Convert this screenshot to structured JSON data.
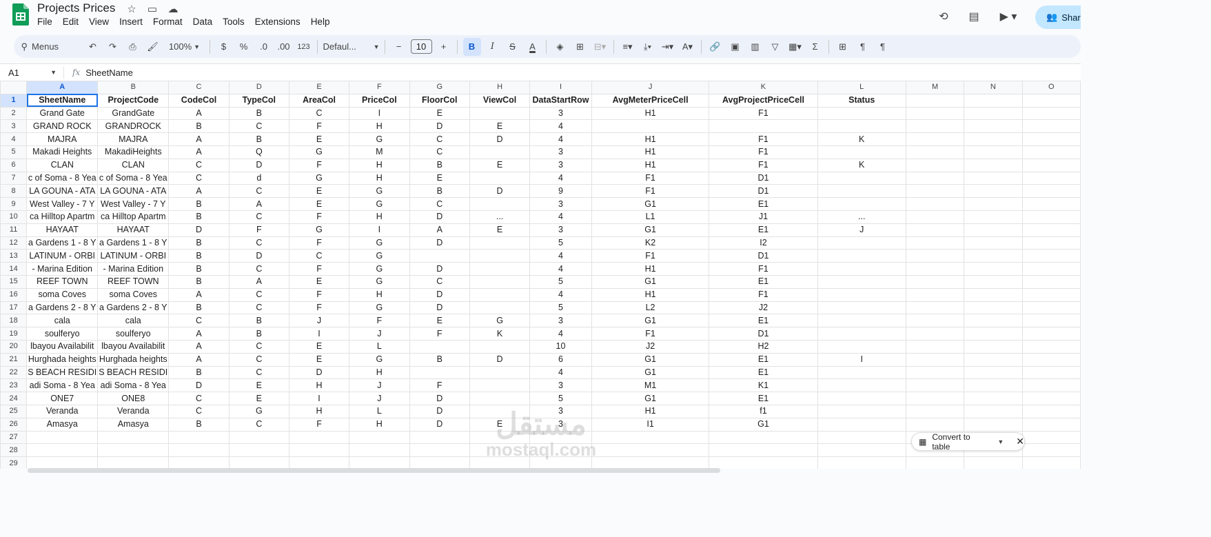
{
  "app": {
    "title": "Projects Prices",
    "menu": [
      "File",
      "Edit",
      "View",
      "Insert",
      "Format",
      "Data",
      "Tools",
      "Extensions",
      "Help"
    ],
    "share_label": "Shar"
  },
  "toolbar": {
    "search_label": "Menus",
    "zoom": "100%",
    "currency": "$",
    "percent": "%",
    "decrease_decimal": ".0",
    "increase_decimal": ".00",
    "number_format": "123",
    "font": "Defaul...",
    "font_size": "10",
    "bold": "B",
    "italic": "I",
    "strike": "S",
    "text_color": "A",
    "sum": "Σ"
  },
  "formula": {
    "cell_ref": "A1",
    "fx": "fx",
    "content": "SheetName"
  },
  "sheet": {
    "columns": [
      "A",
      "B",
      "C",
      "D",
      "E",
      "F",
      "G",
      "H",
      "I",
      "J",
      "K",
      "L",
      "M",
      "N",
      "O"
    ],
    "rows": [
      [
        "SheetName",
        "ProjectCode",
        "CodeCol",
        "TypeCol",
        "AreaCol",
        "PriceCol",
        "FloorCol",
        "ViewCol",
        "DataStartRow",
        "AvgMeterPriceCell",
        "AvgProjectPriceCell",
        "Status"
      ],
      [
        "Grand Gate",
        "GrandGate",
        "A",
        "B",
        "C",
        "I",
        "E",
        "",
        "3",
        "H1",
        "F1",
        ""
      ],
      [
        "GRAND ROCK",
        "GRANDROCK",
        "B",
        "C",
        "F",
        "H",
        "D",
        "E",
        "4",
        "",
        "",
        ""
      ],
      [
        "MAJRA",
        "MAJRA",
        "A",
        "B",
        "E",
        "G",
        "C",
        "D",
        "4",
        "H1",
        "F1",
        "K"
      ],
      [
        "Makadi Heights",
        "MakadiHeights",
        "A",
        "Q",
        "G",
        "M",
        "C",
        "",
        "3",
        "H1",
        "F1",
        ""
      ],
      [
        "CLAN",
        "CLAN",
        "C",
        "D",
        "F",
        "H",
        "B",
        "E",
        "3",
        "H1",
        "F1",
        "K"
      ],
      [
        "c of Soma - 8 Yea",
        "c of Soma - 8 Yea",
        "C",
        "d",
        "G",
        "H",
        "E",
        "",
        "4",
        "F1",
        "D1",
        ""
      ],
      [
        "LA GOUNA - ATA",
        "LA GOUNA - ATA",
        "A",
        "C",
        "E",
        "G",
        "B",
        "D",
        "9",
        "F1",
        "D1",
        ""
      ],
      [
        "West Valley  - 7 Y",
        "West Valley  - 7 Y",
        "B",
        "A",
        "E",
        "G",
        "C",
        "",
        "3",
        "G1",
        "E1",
        ""
      ],
      [
        "ca Hilltop Apartm",
        "ca Hilltop Apartm",
        "B",
        "C",
        "F",
        "H",
        "D",
        "...",
        "4",
        "L1",
        "J1",
        "..."
      ],
      [
        "HAYAAT",
        "HAYAAT",
        "D",
        "F",
        "G",
        "I",
        "A",
        "E",
        "3",
        "G1",
        "E1",
        "J"
      ],
      [
        "a Gardens 1 - 8 Y",
        "a Gardens 1 - 8 Y",
        "B",
        "C",
        "F",
        "G",
        "D",
        "",
        "5",
        "K2",
        "I2",
        ""
      ],
      [
        "LATINUM - ORBI",
        "LATINUM - ORBI",
        "B",
        "D",
        "C",
        "G",
        "",
        "",
        "4",
        "F1",
        "D1",
        ""
      ],
      [
        "- Marina Edition",
        "- Marina Edition",
        "B",
        "C",
        "F",
        "G",
        "D",
        "",
        "4",
        "H1",
        "F1",
        ""
      ],
      [
        "REEF TOWN",
        "REEF TOWN",
        "B",
        "A",
        "E",
        "G",
        "C",
        "",
        "5",
        "G1",
        "E1",
        ""
      ],
      [
        "soma Coves",
        "soma Coves",
        "A",
        "C",
        "F",
        "H",
        "D",
        "",
        "4",
        "H1",
        "F1",
        ""
      ],
      [
        "a Gardens 2 - 8 Y",
        "a Gardens 2 - 8 Y",
        "B",
        "C",
        "F",
        "G",
        "D",
        "",
        "5",
        "L2",
        "J2",
        ""
      ],
      [
        "cala",
        "cala",
        "C",
        "B",
        "J",
        "F",
        "E",
        "G",
        "3",
        "G1",
        "E1",
        ""
      ],
      [
        "soulferyo",
        "soulferyo",
        "A",
        "B",
        "I",
        "J",
        "F",
        "K",
        "4",
        "F1",
        "D1",
        ""
      ],
      [
        "lbayou Availabilit",
        "lbayou Availabilit",
        "A",
        "C",
        "E",
        "L",
        "",
        "",
        "10",
        "J2",
        "H2",
        ""
      ],
      [
        "Hurghada heights",
        "Hurghada heights",
        "A",
        "C",
        "E",
        "G",
        "B",
        "D",
        "6",
        "G1",
        "E1",
        "I"
      ],
      [
        "S BEACH RESIDI",
        "S BEACH RESIDI",
        "B",
        "C",
        "D",
        "H",
        "",
        "",
        "4",
        "G1",
        "E1",
        ""
      ],
      [
        "adi Soma - 8 Yea",
        "adi Soma - 8 Yea",
        "D",
        "E",
        "H",
        "J",
        "F",
        "",
        "3",
        "M1",
        "K1",
        ""
      ],
      [
        "ONE7",
        "ONE8",
        "C",
        "E",
        "I",
        "J",
        "D",
        "",
        "5",
        "G1",
        "E1",
        ""
      ],
      [
        "Veranda",
        "Veranda",
        "C",
        "G",
        "H",
        "L",
        "D",
        "",
        "3",
        "H1",
        "f1",
        ""
      ],
      [
        "Amasya",
        "Amasya",
        "B",
        "C",
        "F",
        "H",
        "D",
        "E",
        "3",
        "I1",
        "G1",
        ""
      ],
      [
        "",
        "",
        "",
        "",
        "",
        "",
        "",
        "",
        "",
        "",
        "",
        ""
      ],
      [
        "",
        "",
        "",
        "",
        "",
        "",
        "",
        "",
        "",
        "",
        "",
        ""
      ],
      [
        "",
        "",
        "",
        "",
        "",
        "",
        "",
        "",
        "",
        "",
        "",
        ""
      ]
    ]
  },
  "popup": {
    "convert_label": "Convert to table"
  },
  "watermark": {
    "arabic": "مستقل",
    "latin": "mostaql.com"
  },
  "colors": {
    "accent": "#1a73e8",
    "share_bg": "#c2e7ff",
    "toolbar_bg": "#edf2fa",
    "selected_header": "#d3e3fd"
  }
}
